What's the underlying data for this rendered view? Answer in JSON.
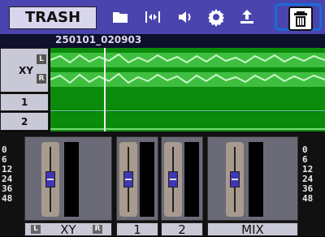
{
  "toolbar": {
    "mode_label": "TRASH",
    "icons": [
      "folder-icon",
      "trim-icon",
      "speaker-icon",
      "settings-icon",
      "export-icon",
      "trash-icon"
    ]
  },
  "file": {
    "name": "250101_020903"
  },
  "tracks": [
    {
      "label": "XY",
      "channels": [
        "L",
        "R"
      ]
    },
    {
      "label": "1"
    },
    {
      "label": "2"
    }
  ],
  "mixer": {
    "scale": [
      "0",
      "6",
      "12",
      "24",
      "36",
      "48"
    ],
    "channels": [
      {
        "label": "XY",
        "left": "L",
        "right": "R"
      },
      {
        "label": "1"
      },
      {
        "label": "2"
      },
      {
        "label": "MIX"
      }
    ]
  },
  "colors": {
    "toolbar": "#4a44ae",
    "waveform": "#0b8a0b",
    "wave_peak": "#75d975",
    "selection": "#1a6bd6",
    "fader_knob": "#3d36b5"
  }
}
